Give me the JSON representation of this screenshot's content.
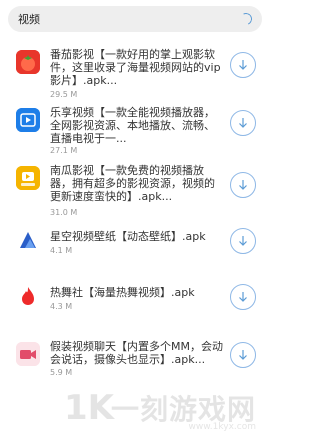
{
  "search": {
    "query": "视频"
  },
  "apps": [
    {
      "title": "番茄影视【一款好用的掌上观影软件，这里收录了海量视频网站的vip影片】.apk...",
      "size": "29.5 M",
      "icon": "tomato-icon",
      "color": "#e8362b"
    },
    {
      "title": "乐享视频【一款全能视频播放器，全网影视资源、本地播放、流畅、直播电视于一...",
      "size": "27.1 M",
      "icon": "play-icon",
      "color": "#1e7ee8"
    },
    {
      "title": "南瓜影视【一款免费的视频播放器，拥有超多的影视资源，视频的更新速度蛮快的】.apk...",
      "size": "31.0 M",
      "icon": "pumpkin-icon",
      "color": "#f5b400"
    },
    {
      "title": "星空视频壁纸【动态壁纸】.apk",
      "size": "4.1 M",
      "icon": "starry-sky-icon",
      "color": "#2a5ec8"
    },
    {
      "title": "热舞社【海量热舞视频】.apk",
      "size": "4.3 M",
      "icon": "flame-icon",
      "color": "#ee2a2a"
    },
    {
      "title": "假装视频聊天【内置多个MM，会动会说话，摄像头也显示】.apk...",
      "size": "5.9 M",
      "icon": "video-camera-icon",
      "color": "#e24c6a"
    }
  ],
  "watermark": {
    "logo": "1K",
    "text": "一刻游戏网",
    "url": "www.1kyx.com"
  }
}
